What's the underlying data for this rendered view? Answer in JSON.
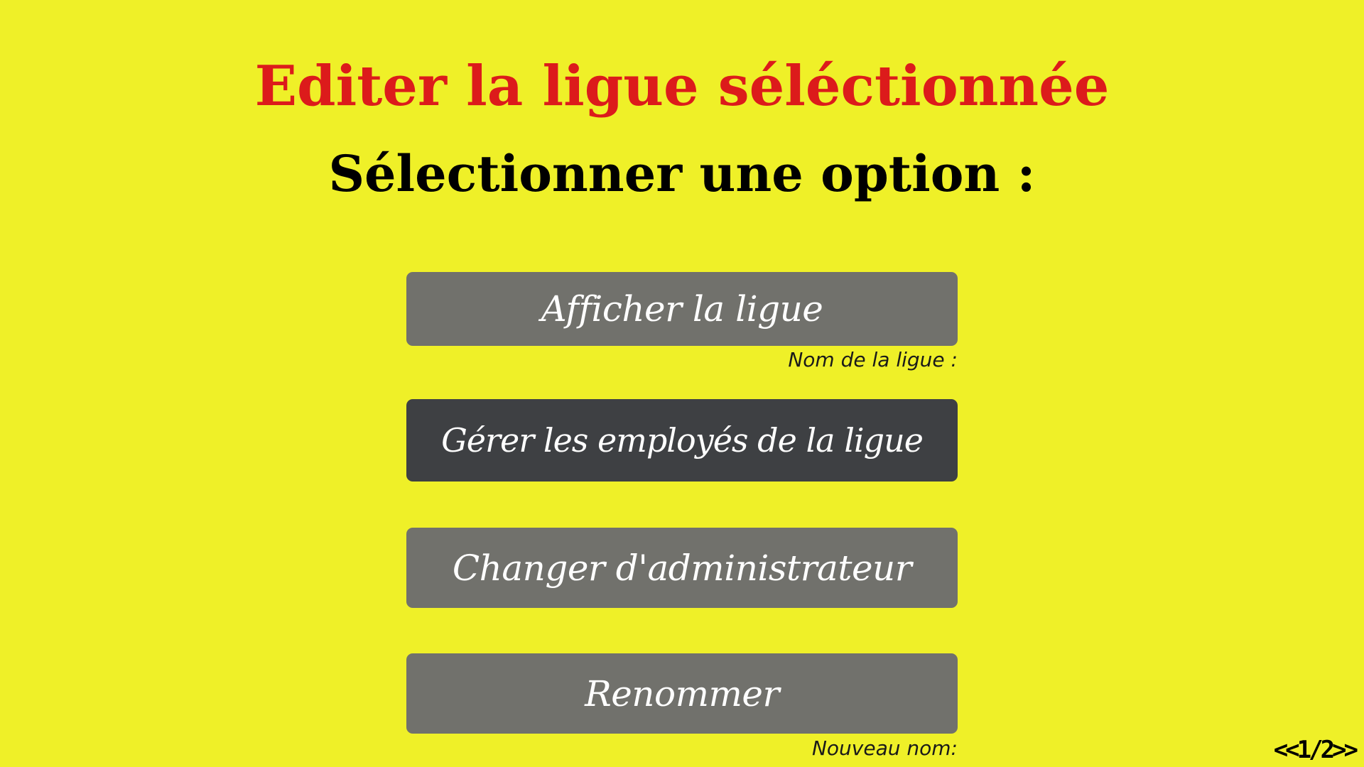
{
  "header": {
    "title": "Editer la ligue séléctionnée",
    "subtitle": "Sélectionner une option :"
  },
  "menu": {
    "afficher": "Afficher la ligue",
    "gerer": "Gérer les employés de la ligue",
    "changer": "Changer d'administrateur",
    "renommer": "Renommer"
  },
  "fields": {
    "nom_label": "Nom de la ligue :",
    "nouveau_label": "Nouveau nom:"
  },
  "pager": {
    "text": "<<1/2>>"
  },
  "colors": {
    "background": "#eff028",
    "title": "#dc1b1b",
    "button": "#71716c",
    "button_active": "#3e4043"
  }
}
